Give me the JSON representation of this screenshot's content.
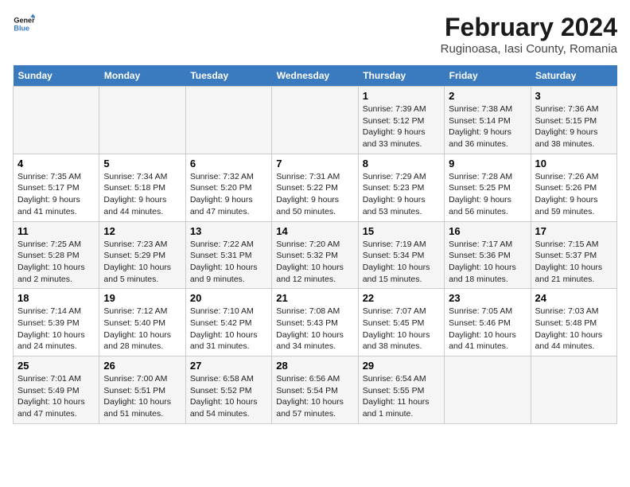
{
  "header": {
    "logo_line1": "General",
    "logo_line2": "Blue",
    "main_title": "February 2024",
    "subtitle": "Ruginoasa, Iasi County, Romania"
  },
  "days_of_week": [
    "Sunday",
    "Monday",
    "Tuesday",
    "Wednesday",
    "Thursday",
    "Friday",
    "Saturday"
  ],
  "weeks": [
    [
      {
        "day": "",
        "info": ""
      },
      {
        "day": "",
        "info": ""
      },
      {
        "day": "",
        "info": ""
      },
      {
        "day": "",
        "info": ""
      },
      {
        "day": "1",
        "info": "Sunrise: 7:39 AM\nSunset: 5:12 PM\nDaylight: 9 hours and 33 minutes."
      },
      {
        "day": "2",
        "info": "Sunrise: 7:38 AM\nSunset: 5:14 PM\nDaylight: 9 hours and 36 minutes."
      },
      {
        "day": "3",
        "info": "Sunrise: 7:36 AM\nSunset: 5:15 PM\nDaylight: 9 hours and 38 minutes."
      }
    ],
    [
      {
        "day": "4",
        "info": "Sunrise: 7:35 AM\nSunset: 5:17 PM\nDaylight: 9 hours and 41 minutes."
      },
      {
        "day": "5",
        "info": "Sunrise: 7:34 AM\nSunset: 5:18 PM\nDaylight: 9 hours and 44 minutes."
      },
      {
        "day": "6",
        "info": "Sunrise: 7:32 AM\nSunset: 5:20 PM\nDaylight: 9 hours and 47 minutes."
      },
      {
        "day": "7",
        "info": "Sunrise: 7:31 AM\nSunset: 5:22 PM\nDaylight: 9 hours and 50 minutes."
      },
      {
        "day": "8",
        "info": "Sunrise: 7:29 AM\nSunset: 5:23 PM\nDaylight: 9 hours and 53 minutes."
      },
      {
        "day": "9",
        "info": "Sunrise: 7:28 AM\nSunset: 5:25 PM\nDaylight: 9 hours and 56 minutes."
      },
      {
        "day": "10",
        "info": "Sunrise: 7:26 AM\nSunset: 5:26 PM\nDaylight: 9 hours and 59 minutes."
      }
    ],
    [
      {
        "day": "11",
        "info": "Sunrise: 7:25 AM\nSunset: 5:28 PM\nDaylight: 10 hours and 2 minutes."
      },
      {
        "day": "12",
        "info": "Sunrise: 7:23 AM\nSunset: 5:29 PM\nDaylight: 10 hours and 5 minutes."
      },
      {
        "day": "13",
        "info": "Sunrise: 7:22 AM\nSunset: 5:31 PM\nDaylight: 10 hours and 9 minutes."
      },
      {
        "day": "14",
        "info": "Sunrise: 7:20 AM\nSunset: 5:32 PM\nDaylight: 10 hours and 12 minutes."
      },
      {
        "day": "15",
        "info": "Sunrise: 7:19 AM\nSunset: 5:34 PM\nDaylight: 10 hours and 15 minutes."
      },
      {
        "day": "16",
        "info": "Sunrise: 7:17 AM\nSunset: 5:36 PM\nDaylight: 10 hours and 18 minutes."
      },
      {
        "day": "17",
        "info": "Sunrise: 7:15 AM\nSunset: 5:37 PM\nDaylight: 10 hours and 21 minutes."
      }
    ],
    [
      {
        "day": "18",
        "info": "Sunrise: 7:14 AM\nSunset: 5:39 PM\nDaylight: 10 hours and 24 minutes."
      },
      {
        "day": "19",
        "info": "Sunrise: 7:12 AM\nSunset: 5:40 PM\nDaylight: 10 hours and 28 minutes."
      },
      {
        "day": "20",
        "info": "Sunrise: 7:10 AM\nSunset: 5:42 PM\nDaylight: 10 hours and 31 minutes."
      },
      {
        "day": "21",
        "info": "Sunrise: 7:08 AM\nSunset: 5:43 PM\nDaylight: 10 hours and 34 minutes."
      },
      {
        "day": "22",
        "info": "Sunrise: 7:07 AM\nSunset: 5:45 PM\nDaylight: 10 hours and 38 minutes."
      },
      {
        "day": "23",
        "info": "Sunrise: 7:05 AM\nSunset: 5:46 PM\nDaylight: 10 hours and 41 minutes."
      },
      {
        "day": "24",
        "info": "Sunrise: 7:03 AM\nSunset: 5:48 PM\nDaylight: 10 hours and 44 minutes."
      }
    ],
    [
      {
        "day": "25",
        "info": "Sunrise: 7:01 AM\nSunset: 5:49 PM\nDaylight: 10 hours and 47 minutes."
      },
      {
        "day": "26",
        "info": "Sunrise: 7:00 AM\nSunset: 5:51 PM\nDaylight: 10 hours and 51 minutes."
      },
      {
        "day": "27",
        "info": "Sunrise: 6:58 AM\nSunset: 5:52 PM\nDaylight: 10 hours and 54 minutes."
      },
      {
        "day": "28",
        "info": "Sunrise: 6:56 AM\nSunset: 5:54 PM\nDaylight: 10 hours and 57 minutes."
      },
      {
        "day": "29",
        "info": "Sunrise: 6:54 AM\nSunset: 5:55 PM\nDaylight: 11 hours and 1 minute."
      },
      {
        "day": "",
        "info": ""
      },
      {
        "day": "",
        "info": ""
      }
    ]
  ]
}
